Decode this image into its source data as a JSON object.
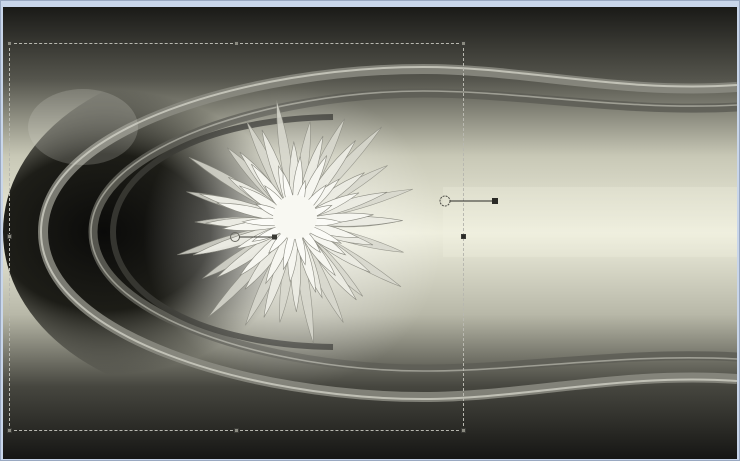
{
  "canvas": {
    "content": "image-canvas"
  },
  "transform": {
    "selection": "transform-selection-box"
  },
  "colors": {
    "window_border": "#9aa9c2",
    "window_bg": "#c9d6ea",
    "image_dark": "#1e1e1a",
    "image_mid": "#6d6d63",
    "image_light": "#e8e8d8",
    "flower_white": "#f4f4ee",
    "selection_line": "#b8b8b0"
  }
}
